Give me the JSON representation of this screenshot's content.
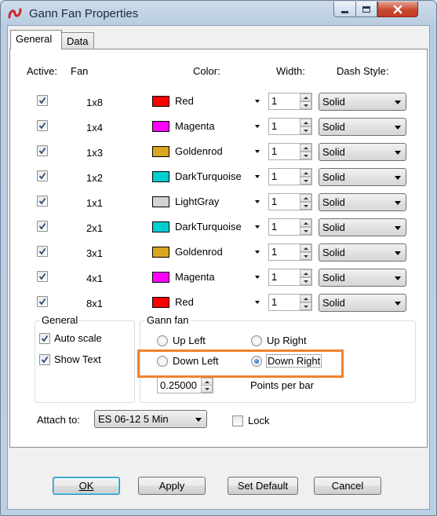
{
  "window": {
    "title": "Gann Fan Properties"
  },
  "tabs": [
    {
      "label": "General"
    },
    {
      "label": "Data"
    }
  ],
  "headers": {
    "active": "Active:",
    "fan": "Fan",
    "color": "Color:",
    "width": "Width:",
    "dash_style": "Dash Style:"
  },
  "rows": [
    {
      "fan": "1x8",
      "active": true,
      "color": "Red",
      "swatch": "#ff0000",
      "width": "1",
      "dash": "Solid"
    },
    {
      "fan": "1x4",
      "active": true,
      "color": "Magenta",
      "swatch": "#ff00ff",
      "width": "1",
      "dash": "Solid"
    },
    {
      "fan": "1x3",
      "active": true,
      "color": "Goldenrod",
      "swatch": "#daa520",
      "width": "1",
      "dash": "Solid"
    },
    {
      "fan": "1x2",
      "active": true,
      "color": "DarkTurquoise",
      "swatch": "#00ced1",
      "width": "1",
      "dash": "Solid"
    },
    {
      "fan": "1x1",
      "active": true,
      "color": "LightGray",
      "swatch": "#d3d3d3",
      "width": "1",
      "dash": "Solid"
    },
    {
      "fan": "2x1",
      "active": true,
      "color": "DarkTurquoise",
      "swatch": "#00ced1",
      "width": "1",
      "dash": "Solid"
    },
    {
      "fan": "3x1",
      "active": true,
      "color": "Goldenrod",
      "swatch": "#daa520",
      "width": "1",
      "dash": "Solid"
    },
    {
      "fan": "4x1",
      "active": true,
      "color": "Magenta",
      "swatch": "#ff00ff",
      "width": "1",
      "dash": "Solid"
    },
    {
      "fan": "8x1",
      "active": true,
      "color": "Red",
      "swatch": "#ff0000",
      "width": "1",
      "dash": "Solid"
    }
  ],
  "general_group": {
    "title": "General",
    "auto_scale": {
      "label": "Auto scale",
      "checked": true
    },
    "show_text": {
      "label": "Show Text",
      "checked": true
    }
  },
  "gann_group": {
    "title": "Gann fan",
    "up_left": "Up Left",
    "up_right": "Up Right",
    "down_left": "Down Left",
    "down_right": "Down Right",
    "selected": "Down Right",
    "points_value": "0.25000",
    "points_label": "Points per bar"
  },
  "attach": {
    "label": "Attach to:",
    "value": "ES 06-12 5 Min"
  },
  "lock": {
    "label": "Lock",
    "checked": false
  },
  "buttons": {
    "ok": "OK",
    "apply": "Apply",
    "set_default": "Set Default",
    "cancel": "Cancel"
  },
  "colors": {
    "highlight": "#f0822d"
  },
  "icons": {
    "app": "app-logo-icon",
    "check": "checkmark-icon"
  }
}
